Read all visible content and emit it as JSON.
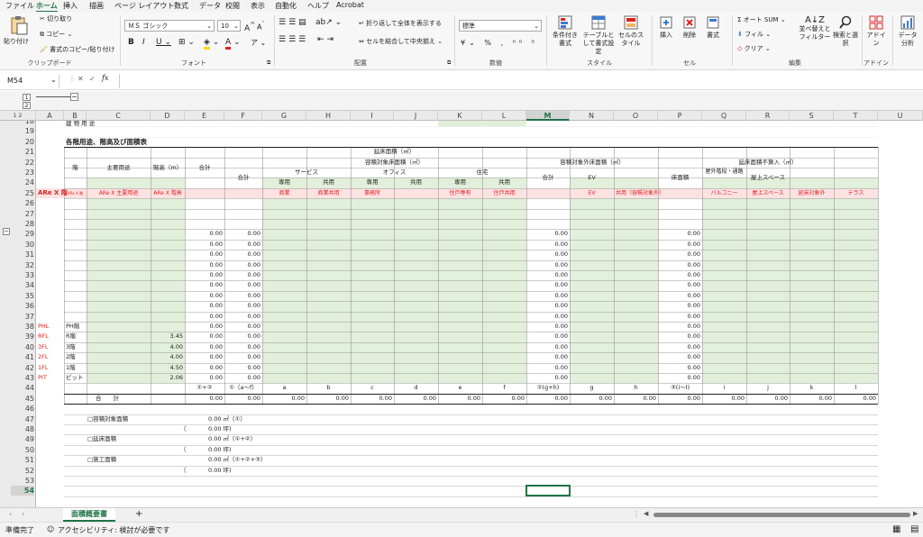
{
  "menu": [
    "ファイル",
    "ホーム",
    "挿入",
    "描画",
    "ページ レイアウト",
    "数式",
    "データ",
    "校閲",
    "表示",
    "自動化",
    "ヘルプ",
    "Acrobat"
  ],
  "active_menu": "ホーム",
  "ribbon": {
    "paste": "貼り付け",
    "cut": "切り取り",
    "copy": "コピー",
    "format_painter": "書式のコピー/貼り付け",
    "clipboard": "クリップボード",
    "font_name": "ＭＳ ゴシック",
    "font_size": "10",
    "font_group": "フォント",
    "wrap_text": "折り返して全体を表示する",
    "merge_center": "セルを結合して中央揃え",
    "alignment": "配置",
    "number_format": "標準",
    "number_group": "数値",
    "cond_format": "条件付き書式",
    "table_format": "テーブルとして書式設定",
    "cell_style": "セルのスタイル",
    "style_group": "スタイル",
    "insert": "挿入",
    "delete": "削除",
    "format": "書式",
    "cells_group": "セル",
    "autosum": "オート SUM",
    "fill": "フィル",
    "clear": "クリア",
    "sort_filter": "並べ替えとフィルター",
    "find_select": "検索と選択",
    "editing": "編集",
    "addin": "アドイン",
    "addin_group": "アドイン",
    "data_analysis": "データ分析"
  },
  "formula_bar": {
    "name_box": "M54",
    "fx": "fx",
    "formula": ""
  },
  "columns": [
    "A",
    "B",
    "C",
    "D",
    "E",
    "F",
    "G",
    "H",
    "I",
    "J",
    "K",
    "L",
    "M",
    "N",
    "O",
    "P",
    "Q",
    "R",
    "S",
    "T",
    "U"
  ],
  "rows": [
    "18",
    "19",
    "20",
    "21",
    "22",
    "23",
    "24",
    "25",
    "26",
    "27",
    "28",
    "29",
    "30",
    "31",
    "32",
    "33",
    "34",
    "35",
    "36",
    "37",
    "38",
    "39",
    "40",
    "41",
    "42",
    "43",
    "44",
    "45",
    "46",
    "47",
    "48",
    "49",
    "50",
    "51",
    "52",
    "53",
    "54"
  ],
  "outline_levels": [
    "1",
    "2"
  ],
  "sheet": {
    "r18": "建 物 用 途",
    "title": "各階用途、階高及び面積表",
    "floor_area_header": "延床面積（㎡）",
    "floor": "階",
    "main_use": "主要用途",
    "floor_height": "階高（m）",
    "total": "合計",
    "capacity_target": "容積対象床面積（㎡）",
    "capacity_excluded": "容積対象外床面積（㎡）",
    "not_counted": "延床面積不算入（㎡）",
    "service": "サービス",
    "office": "オフィス",
    "housing": "住宅",
    "dedicated": "専用",
    "shared": "共用",
    "ev": "EV",
    "floor_area": "床面積",
    "outdoor_stair": "屋外階段・通路",
    "rooftop_space": "屋上スペース",
    "r25": [
      "ARe X 階",
      "ARe X 主要用途",
      "ARe X 階高",
      "",
      "",
      "商業",
      "商業共用",
      "事務所",
      "",
      "住戸専有",
      "住戸共用",
      "",
      "EV",
      "共用（容積対象外）",
      "",
      "バルコニー",
      "屋上スペース",
      "延床対象外",
      "テラス"
    ],
    "r25_b": "ARe X 階",
    "zero": "0.00",
    "floors_a": [
      "PHL",
      "RFL",
      "3FL",
      "2FL",
      "1FL",
      "PIT"
    ],
    "floors_b": [
      "PH階",
      "R階",
      "3階",
      "2階",
      "1階",
      "ピット"
    ],
    "heights": [
      "",
      "3.45",
      "4.00",
      "4.00",
      "4.50",
      "2.06"
    ],
    "r44": [
      "①+②",
      "①（a～f）",
      "a",
      "b",
      "c",
      "d",
      "e",
      "f",
      "②(g+h)",
      "g",
      "h",
      "③(i～l)",
      "i",
      "j",
      "k",
      "l"
    ],
    "grand_total": "合　　計",
    "r47": "□容積対象面積",
    "r47_v": "0.00 ㎡（①）",
    "r48_v": "0.00 坪)",
    "r49": "□延床面積",
    "r49_v": "0.00 ㎡（①+②）",
    "r50_v": "0.00 坪)",
    "r51": "□施工面積",
    "r51_v": "0.00 ㎡（①+②+③）",
    "r52_v": "0.00 坪)"
  },
  "sheet_tab": "面積概要書",
  "status": {
    "ready": "準備完了",
    "accessibility": "アクセシビリティ: 検討が必要です"
  },
  "colors": {
    "green": "#e2efda",
    "pink": "#fde2e2",
    "red": "#e02020",
    "excel_green": "#217346"
  }
}
